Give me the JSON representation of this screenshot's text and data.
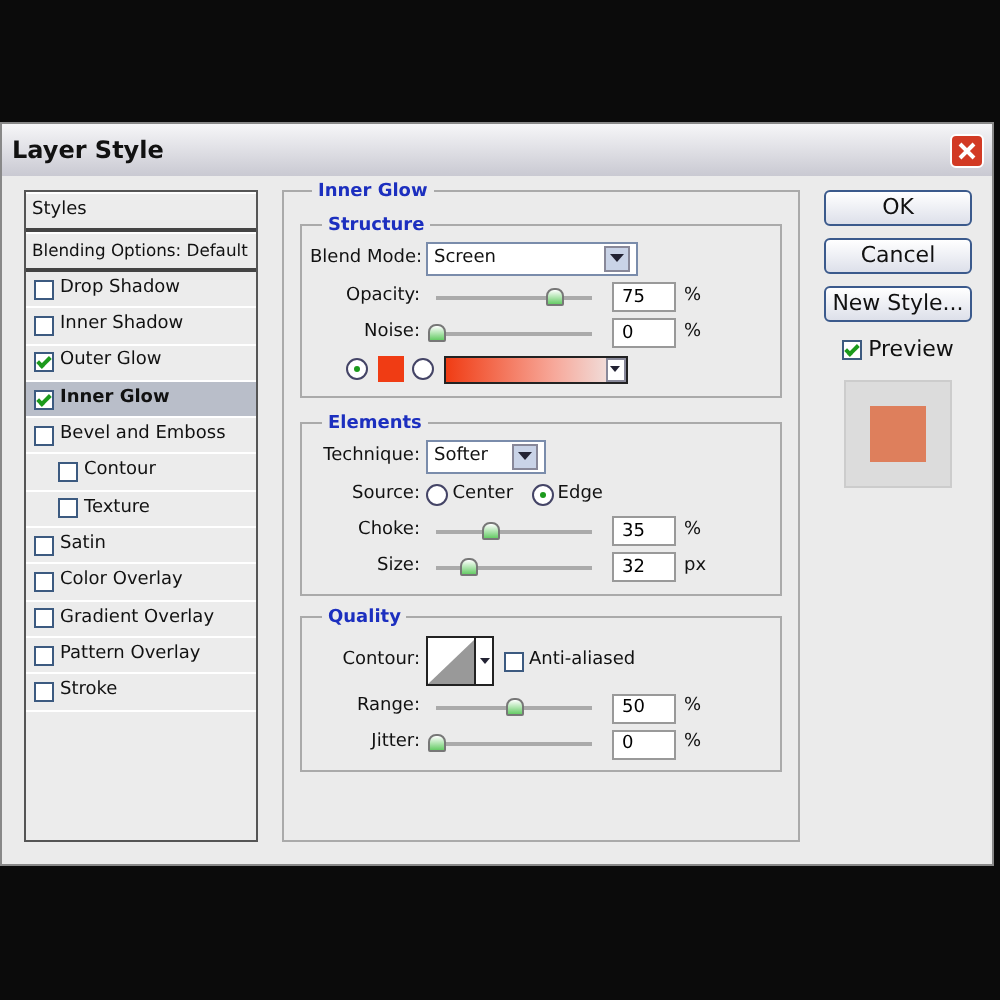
{
  "window": {
    "title": "Layer Style"
  },
  "styles_list": {
    "header": "Styles",
    "items": [
      {
        "label": "Blending Options: Default",
        "kind": "header"
      },
      {
        "label": "Drop Shadow",
        "kind": "check",
        "checked": false,
        "selected": false
      },
      {
        "label": "Inner Shadow",
        "kind": "check",
        "checked": false,
        "selected": false
      },
      {
        "label": "Outer Glow",
        "kind": "check",
        "checked": true,
        "selected": false
      },
      {
        "label": "Inner Glow",
        "kind": "check",
        "checked": true,
        "selected": true
      },
      {
        "label": "Bevel and Emboss",
        "kind": "check",
        "checked": false,
        "selected": false,
        "children": [
          {
            "label": "Contour",
            "kind": "check",
            "checked": false,
            "selected": false
          },
          {
            "label": "Texture",
            "kind": "check",
            "checked": false,
            "selected": false
          }
        ]
      },
      {
        "label": "Satin",
        "kind": "check",
        "checked": false,
        "selected": false
      },
      {
        "label": "Color Overlay",
        "kind": "check",
        "checked": false,
        "selected": false
      },
      {
        "label": "Gradient Overlay",
        "kind": "check",
        "checked": false,
        "selected": false
      },
      {
        "label": "Pattern Overlay",
        "kind": "check",
        "checked": false,
        "selected": false
      },
      {
        "label": "Stroke",
        "kind": "check",
        "checked": false,
        "selected": false
      }
    ]
  },
  "panel": {
    "title": "Inner Glow",
    "structure": {
      "title": "Structure",
      "blend_mode": {
        "label": "Blend Mode:",
        "value": "Screen"
      },
      "sliders": [
        {
          "label": "Opacity:",
          "level": 0.75,
          "value": "75",
          "unit": "%"
        },
        {
          "label": "Noise:",
          "level": 0,
          "value": "0",
          "unit": "%"
        }
      ],
      "fill": [
        {
          "kind": "color",
          "selected": true
        },
        {
          "kind": "gradient",
          "selected": false
        }
      ]
    },
    "elements": {
      "title": "Elements",
      "technique": {
        "label": "Technique:",
        "value": "Softer"
      },
      "source": {
        "label": "Source:",
        "options": [
          {
            "label": "Center",
            "selected": false
          },
          {
            "label": "Edge",
            "selected": true
          }
        ]
      },
      "sliders": [
        {
          "label": "Choke:",
          "level": 0.35,
          "value": "35",
          "unit": "%"
        },
        {
          "label": "Size:",
          "level": 0.2,
          "value": "32",
          "unit": "px"
        }
      ]
    },
    "quality": {
      "title": "Quality",
      "contour_label": "Contour:",
      "anti_aliased": {
        "label": "Anti-aliased",
        "checked": false
      },
      "sliders": [
        {
          "label": "Range:",
          "level": 0.5,
          "value": "50",
          "unit": "%"
        },
        {
          "label": "Jitter:",
          "level": 0,
          "value": "0",
          "unit": "%"
        }
      ]
    }
  },
  "buttons": [
    "OK",
    "Cancel",
    "New Style..."
  ],
  "preview": {
    "label": "Preview",
    "checked": true
  }
}
